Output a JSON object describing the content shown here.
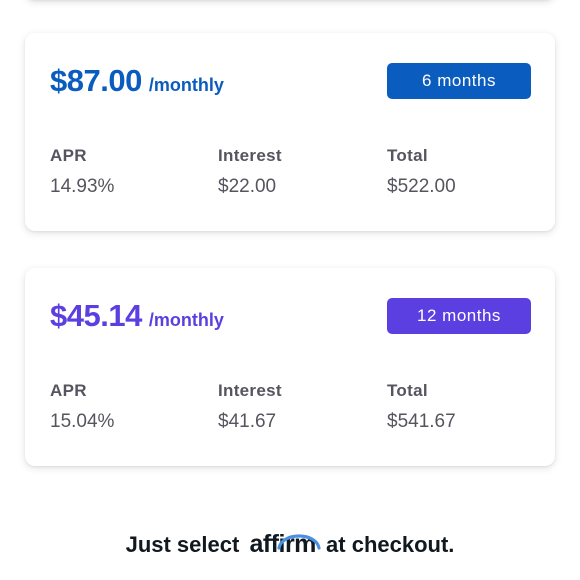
{
  "plans": [
    {
      "amount": "$87.00",
      "period": "/monthly",
      "term": "6 months",
      "accent": "#0b5cbf",
      "apr_label": "APR",
      "apr": "14.93%",
      "interest_label": "Interest",
      "interest": "$22.00",
      "total_label": "Total",
      "total": "$522.00"
    },
    {
      "amount": "$45.14",
      "period": "/monthly",
      "term": "12 months",
      "accent": "#5b3fe0",
      "apr_label": "APR",
      "apr": "15.04%",
      "interest_label": "Interest",
      "interest": "$41.67",
      "total_label": "Total",
      "total": "$541.67"
    }
  ],
  "footer": {
    "prefix": "Just select",
    "brand": "affirm",
    "brand_logo_arc_color": "#4a90e2",
    "suffix": "at checkout."
  }
}
